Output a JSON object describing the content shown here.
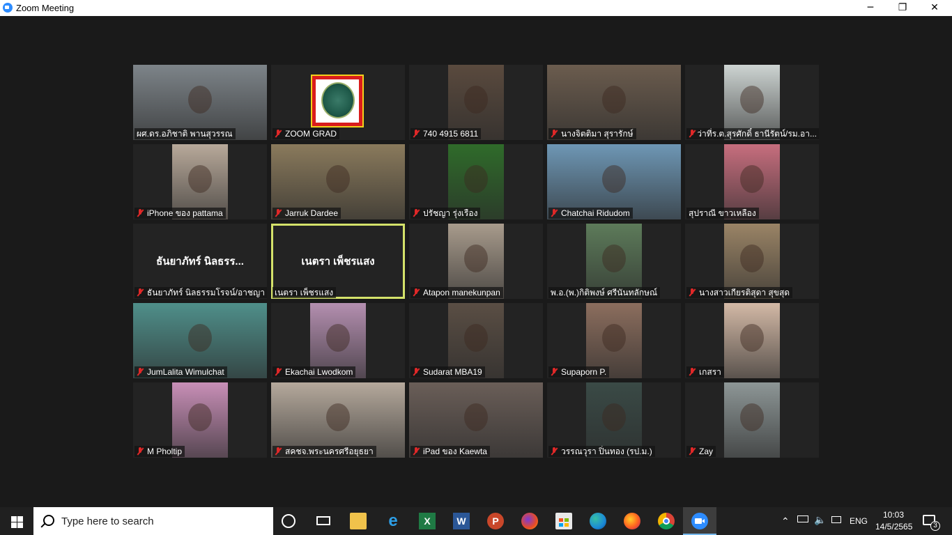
{
  "window": {
    "title": "Zoom Meeting",
    "minimize_icon": "─",
    "restore_icon": "❐",
    "close_icon": "✕"
  },
  "participants": [
    {
      "name": "ผศ.ดร.อภิชาติ พานสุวรรณ",
      "muted": false,
      "video": "#7d8489"
    },
    {
      "name": "ZOOM GRAD",
      "muted": true,
      "logo": true
    },
    {
      "name": "740 4915 6811",
      "muted": true,
      "video": "#5a4a3e"
    },
    {
      "name": "นางจิตติมา สุรารักษ์",
      "muted": true,
      "video": "#6b5c4e"
    },
    {
      "name": "ว่าที่ร.ต.สุรศักดิ์ ธานีรัตน์/รม.อา...",
      "muted": true,
      "video": "#cdd4d2"
    },
    {
      "name": "iPhone ของ pattama",
      "muted": true,
      "video": "#b8a99a"
    },
    {
      "name": "Jarruk Dardee",
      "muted": true,
      "video": "#8a7a5c"
    },
    {
      "name": "ปรัชญา รุ่งเรือง",
      "muted": true,
      "video": "#2f6b2a"
    },
    {
      "name": "Chatchai Ridudom",
      "muted": true,
      "video": "#6e97b5"
    },
    {
      "name": "สุปราณี ขาวเหลือง",
      "muted": false,
      "video": "#c76e7e"
    },
    {
      "name": "ธันยาภัทร์ นิลธรรมโรจน์/อาชญา",
      "muted": true,
      "avatar_text": "ธันยาภัทร์ นิลธรร..."
    },
    {
      "name": "เนตรา เพ็ชรแสง",
      "muted": false,
      "avatar_text": "เนตรา เพ็ชรแสง",
      "active": true
    },
    {
      "name": "Atapon manekunpan",
      "muted": true,
      "video": "#a89b8c"
    },
    {
      "name": "พ.อ.(พ.)กิติพงษ์ ศรีนันทลักษณ์",
      "muted": false,
      "video": "#5d7b5a"
    },
    {
      "name": "นางสาวเกียรติสุดา สุขสุด",
      "muted": true,
      "video": "#9a8466"
    },
    {
      "name": "JumLalita Wimulchat",
      "muted": true,
      "video": "#4f8f8a"
    },
    {
      "name": "Ekachai Lwodkom",
      "muted": true,
      "video": "#b48fb0"
    },
    {
      "name": "Sudarat MBA19",
      "muted": true,
      "video": "#5a4e44"
    },
    {
      "name": "Supaporn P.",
      "muted": true,
      "video": "#8c6e5e"
    },
    {
      "name": "เกสรา",
      "muted": true,
      "video": "#d3b9a6"
    },
    {
      "name": "M Pholtip",
      "muted": true,
      "video": "#c88fb7"
    },
    {
      "name": "สคชจ.พระนครศรีอยุธยา",
      "muted": true,
      "video": "#b5a99c"
    },
    {
      "name": "iPad ของ Kaewta",
      "muted": true,
      "video": "#6a5e58"
    },
    {
      "name": "วรรณวุรา ปิ่นทอง (รป.ม.)",
      "muted": true,
      "video": "#3a4a46"
    },
    {
      "name": "Zay",
      "muted": true,
      "video": "#8d9696"
    }
  ],
  "taskbar": {
    "search_placeholder": "Type here to search",
    "language": "ENG",
    "time": "10:03",
    "date": "14/5/2565",
    "notification_count": "3"
  }
}
